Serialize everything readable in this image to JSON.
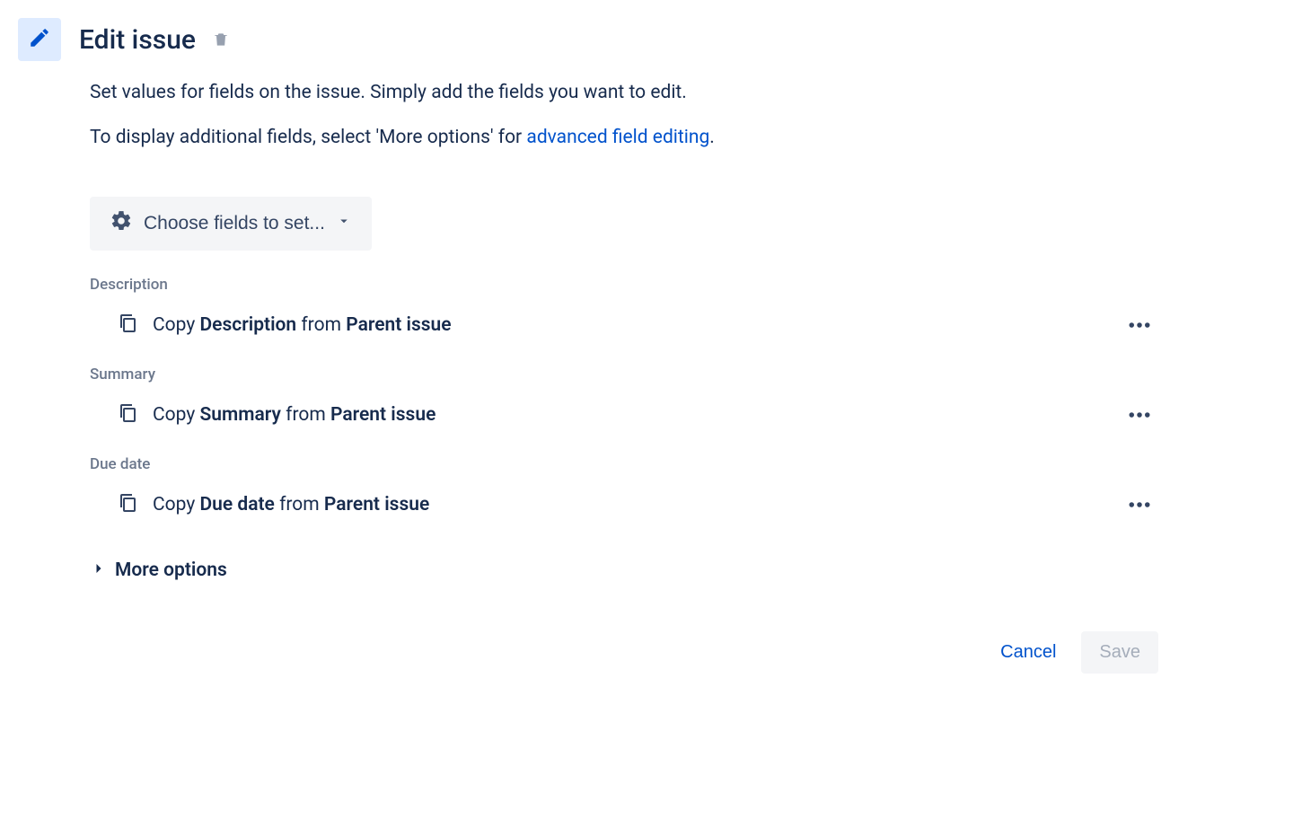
{
  "header": {
    "title": "Edit issue"
  },
  "intro": {
    "line1": "Set values for fields on the issue. Simply add the fields you want to edit.",
    "line2_prefix": "To display additional fields, select 'More options' for ",
    "line2_link": "advanced field editing",
    "line2_suffix": "."
  },
  "choose_fields": {
    "label": "Choose fields to set..."
  },
  "fields": [
    {
      "label": "Description",
      "copy_prefix": "Copy ",
      "copy_field": "Description",
      "copy_mid": " from ",
      "copy_source": "Parent issue"
    },
    {
      "label": "Summary",
      "copy_prefix": "Copy ",
      "copy_field": "Summary",
      "copy_mid": " from ",
      "copy_source": "Parent issue"
    },
    {
      "label": "Due date",
      "copy_prefix": "Copy ",
      "copy_field": "Due date",
      "copy_mid": " from ",
      "copy_source": "Parent issue"
    }
  ],
  "more_options": {
    "label": "More options"
  },
  "footer": {
    "cancel": "Cancel",
    "save": "Save"
  }
}
